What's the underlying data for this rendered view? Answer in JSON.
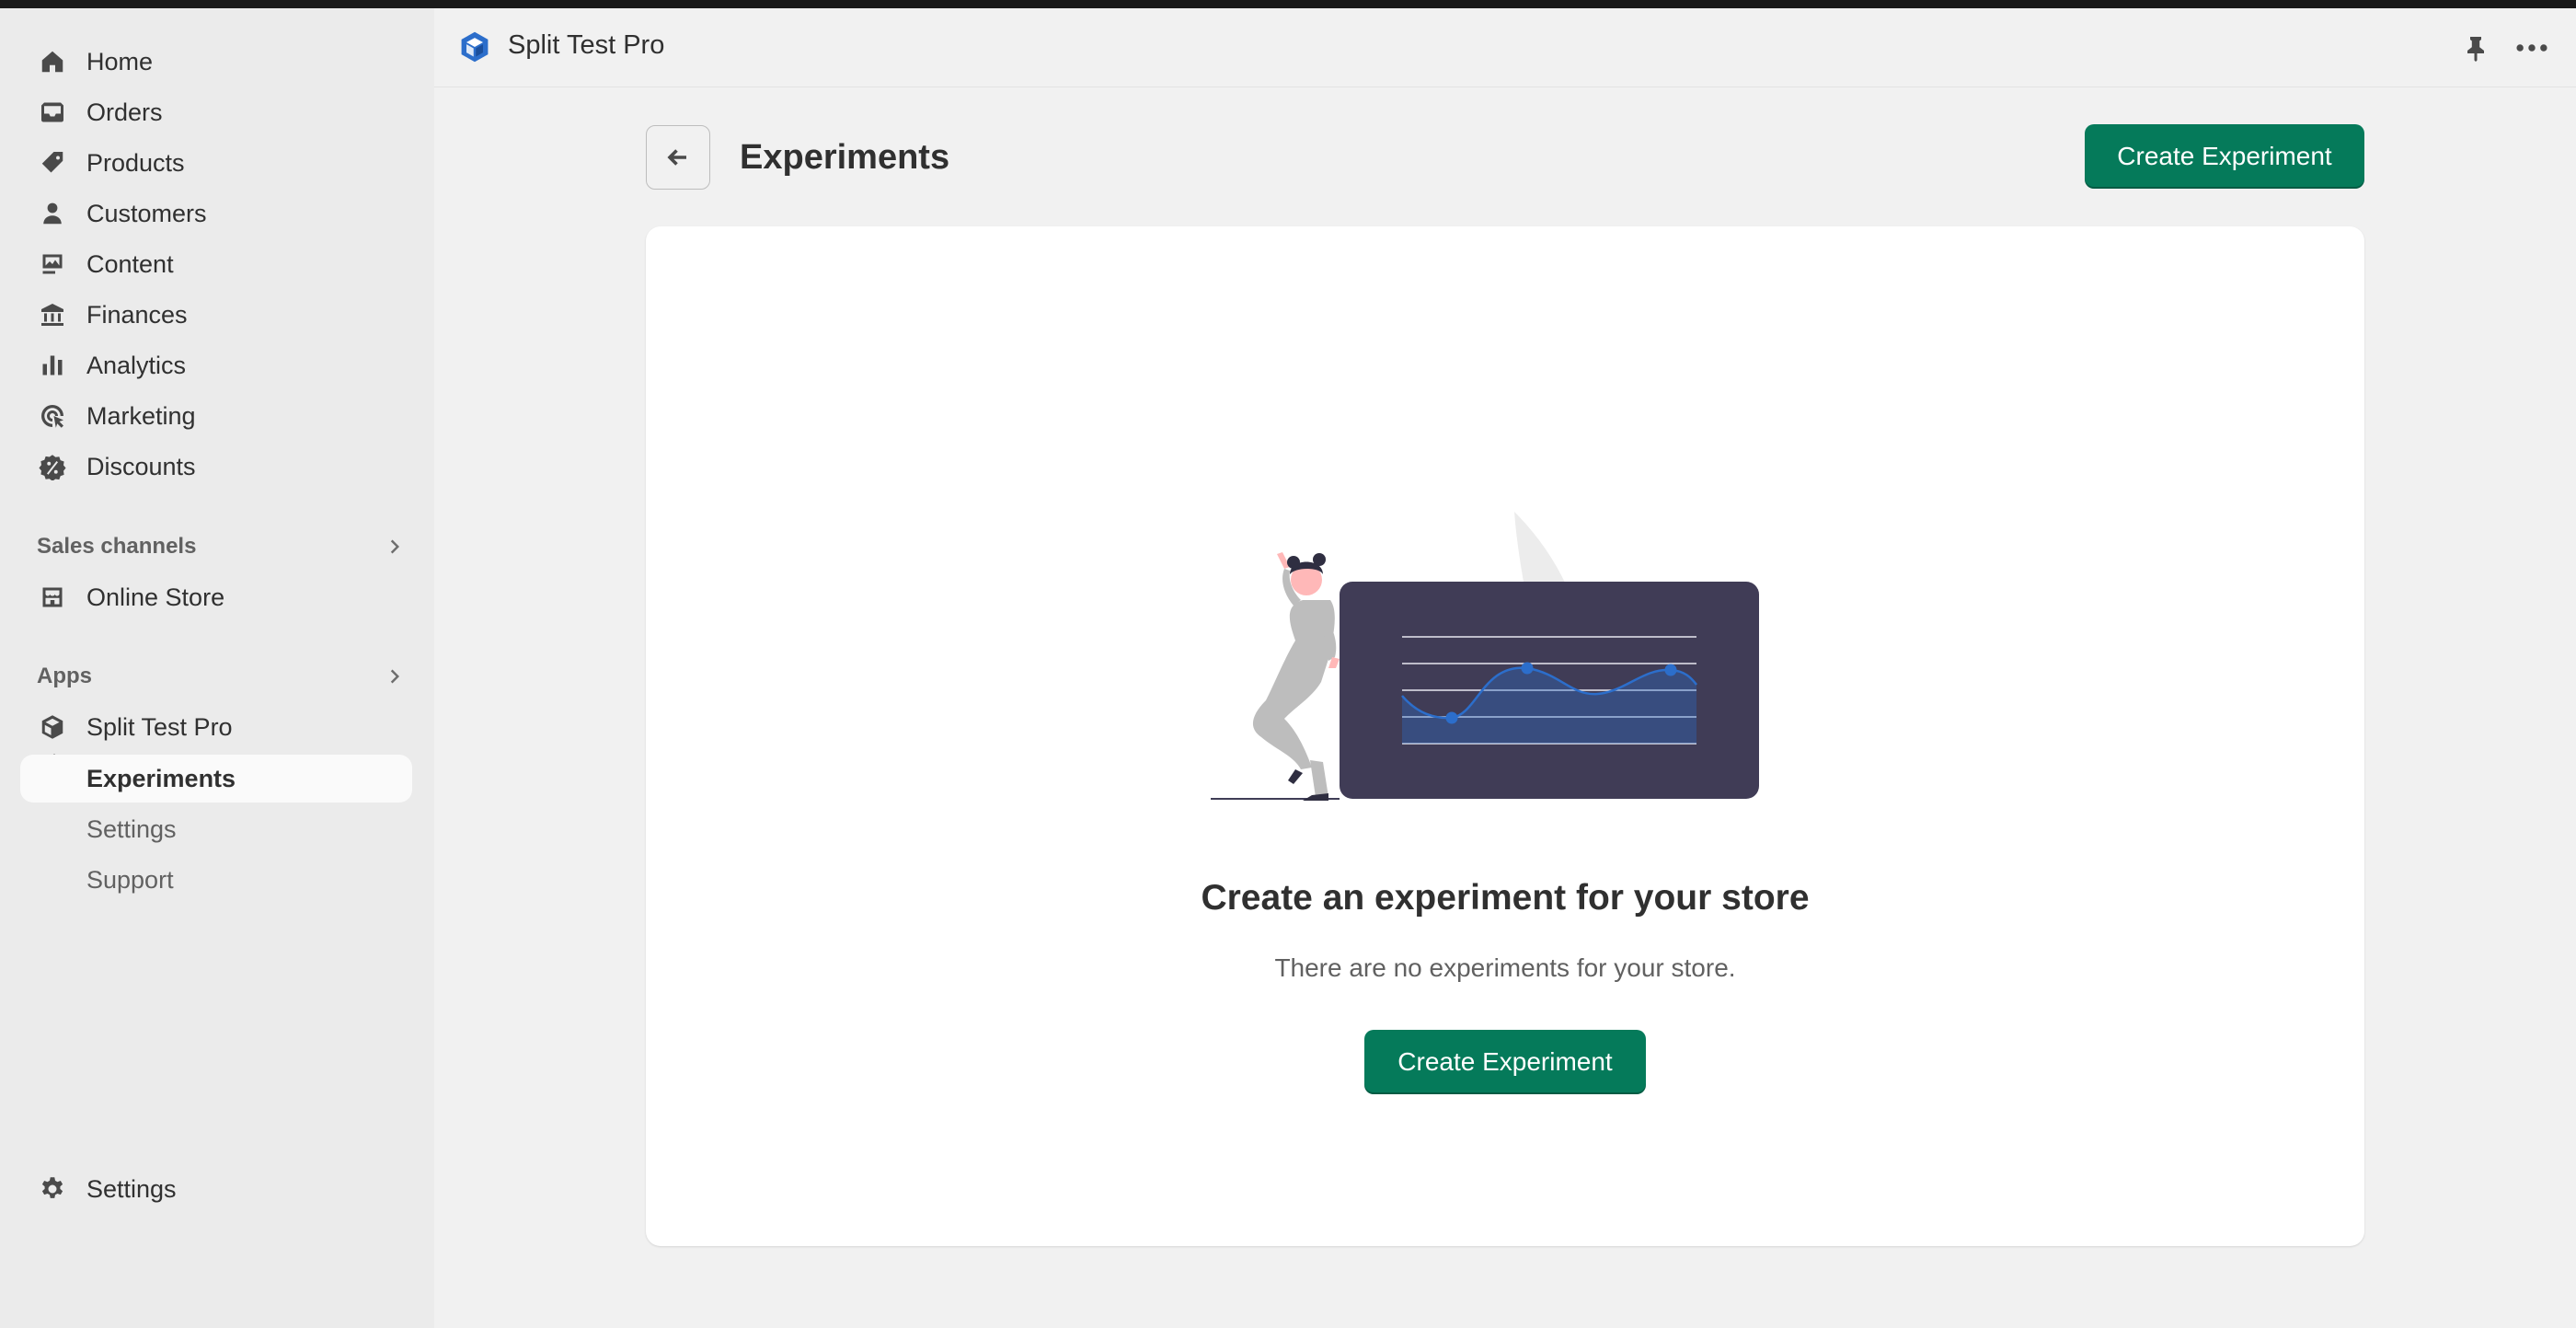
{
  "sidebar": {
    "nav": [
      {
        "label": "Home",
        "icon": "home-icon"
      },
      {
        "label": "Orders",
        "icon": "inbox-icon"
      },
      {
        "label": "Products",
        "icon": "tag-icon"
      },
      {
        "label": "Customers",
        "icon": "person-icon"
      },
      {
        "label": "Content",
        "icon": "image-icon"
      },
      {
        "label": "Finances",
        "icon": "bank-icon"
      },
      {
        "label": "Analytics",
        "icon": "bar-chart-icon"
      },
      {
        "label": "Marketing",
        "icon": "target-icon"
      },
      {
        "label": "Discounts",
        "icon": "discount-icon"
      }
    ],
    "sales_channels": {
      "title": "Sales channels",
      "items": [
        {
          "label": "Online Store",
          "icon": "store-icon"
        }
      ]
    },
    "apps": {
      "title": "Apps",
      "app": {
        "label": "Split Test Pro",
        "icon": "app-cube-icon"
      },
      "subitems": [
        {
          "label": "Experiments",
          "active": true
        },
        {
          "label": "Settings"
        },
        {
          "label": "Support"
        }
      ]
    },
    "settings": {
      "label": "Settings",
      "icon": "gear-icon"
    }
  },
  "appbar": {
    "title": "Split Test Pro",
    "logo_color": "#2c6ecb"
  },
  "page": {
    "title": "Experiments",
    "primary_action": "Create Experiment"
  },
  "empty_state": {
    "heading": "Create an experiment for your store",
    "description": "There are no experiments for your store.",
    "action": "Create Experiment"
  },
  "colors": {
    "primary": "#057a5a",
    "accent": "#2c6ecb"
  }
}
